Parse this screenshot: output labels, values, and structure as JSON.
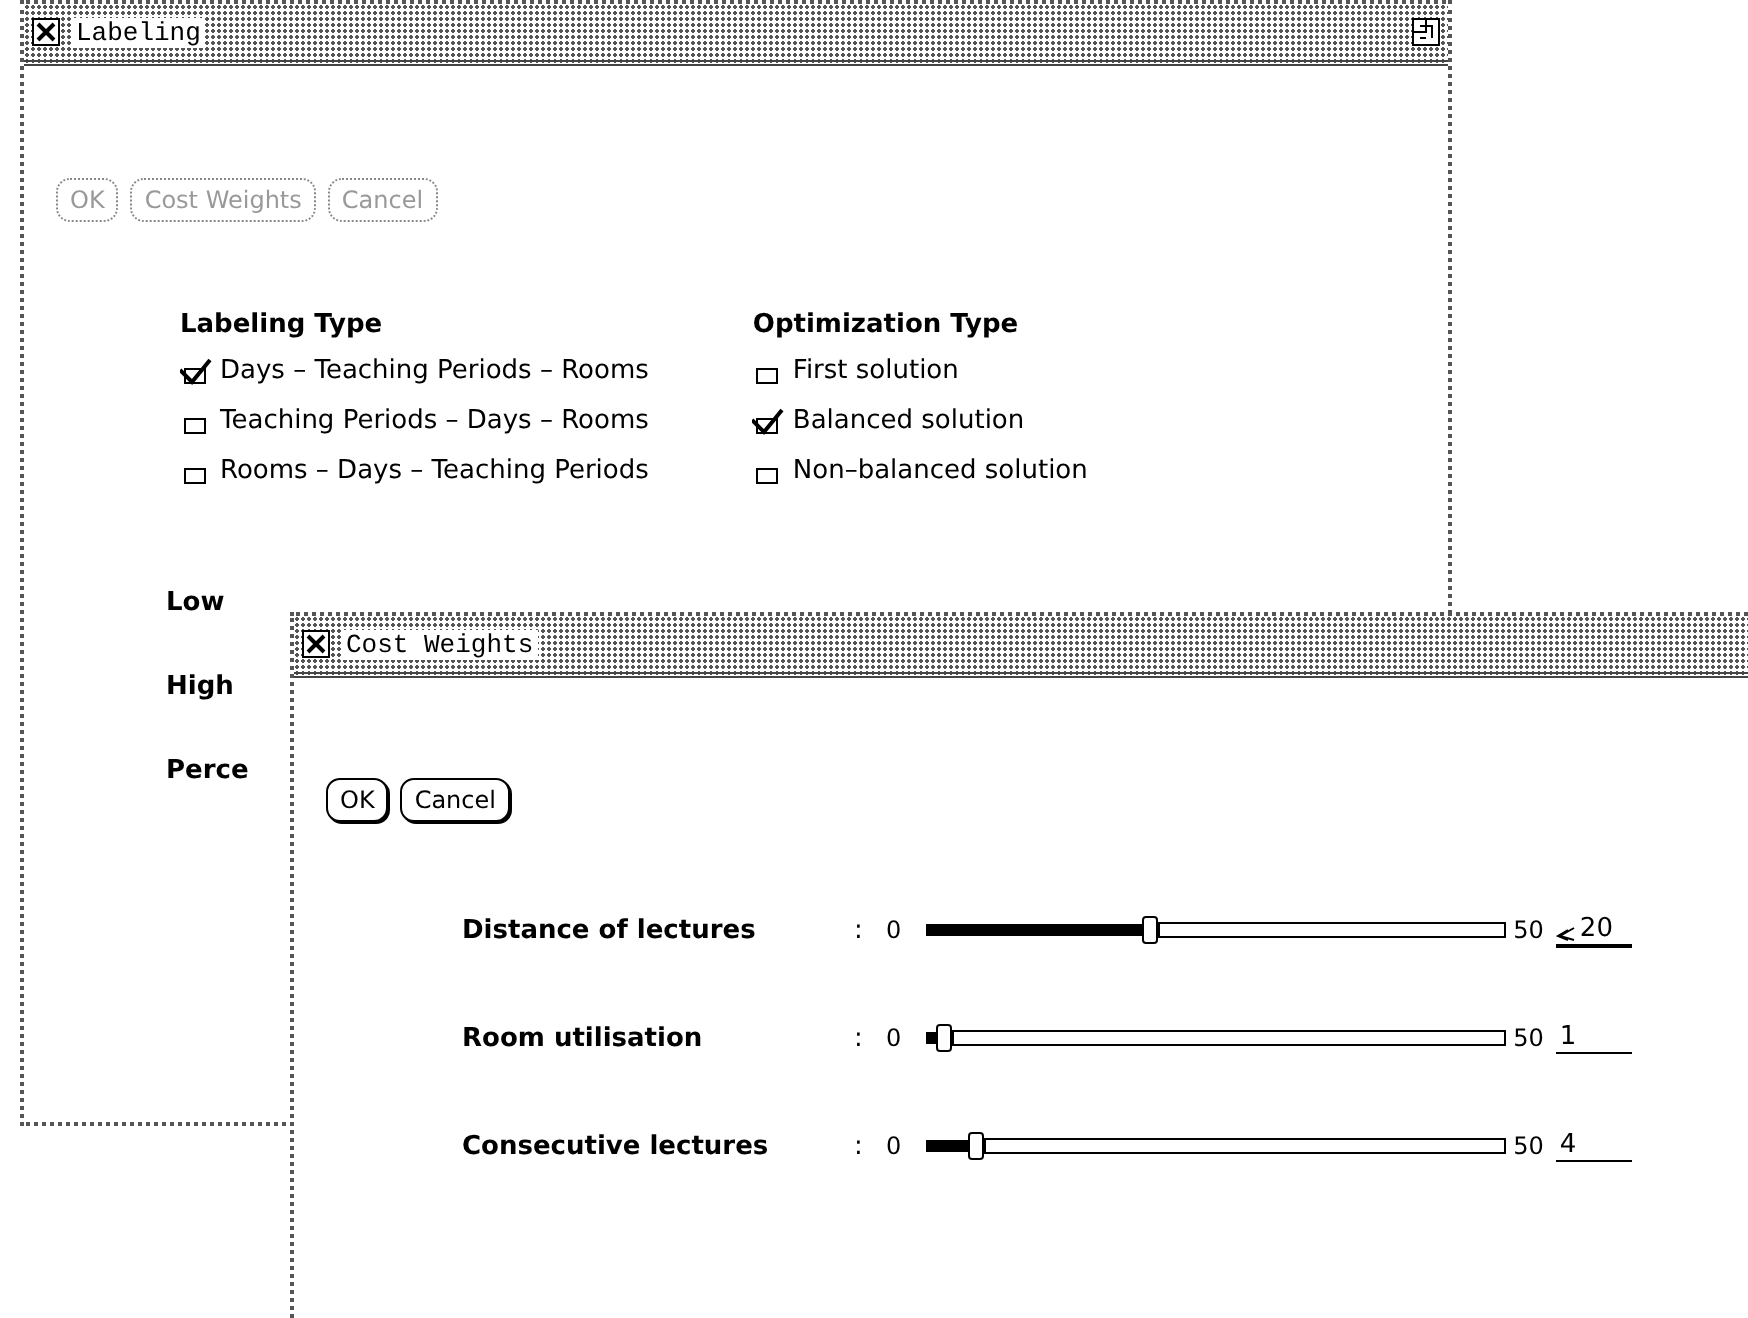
{
  "windows": [
    {
      "title": "Labeling",
      "buttons": [
        {
          "label": "OK",
          "disabled": true
        },
        {
          "label": "Cost Weights",
          "disabled": true
        },
        {
          "label": "Cancel",
          "disabled": true
        }
      ],
      "groups": [
        {
          "heading": "Labeling Type",
          "options": [
            {
              "label": "Days – Teaching Periods – Rooms",
              "checked": true
            },
            {
              "label": "Teaching Periods – Days – Rooms",
              "checked": false
            },
            {
              "label": "Rooms – Days – Teaching Periods",
              "checked": false
            }
          ]
        },
        {
          "heading": "Optimization Type",
          "options": [
            {
              "label": "First solution",
              "checked": false
            },
            {
              "label": "Balanced solution",
              "checked": true
            },
            {
              "label": "Non–balanced solution",
              "checked": false
            }
          ]
        }
      ],
      "labels": [
        "Low",
        "High",
        "Perce"
      ]
    },
    {
      "title": "Cost Weights",
      "buttons": [
        {
          "label": "OK",
          "disabled": false
        },
        {
          "label": "Cancel",
          "disabled": false
        }
      ],
      "sliders": [
        {
          "label": "Distance of lectures",
          "colon": ":",
          "min": "0",
          "max": "50",
          "level": 0.4,
          "value": "20",
          "focused": true
        },
        {
          "label": "Room utilisation",
          "colon": ":",
          "min": "0",
          "max": "50",
          "level": 0.02,
          "value": "1",
          "focused": false
        },
        {
          "label": "Consecutive lectures",
          "colon": ":",
          "min": "0",
          "max": "50",
          "level": 0.08,
          "value": "4",
          "focused": false
        }
      ]
    }
  ]
}
